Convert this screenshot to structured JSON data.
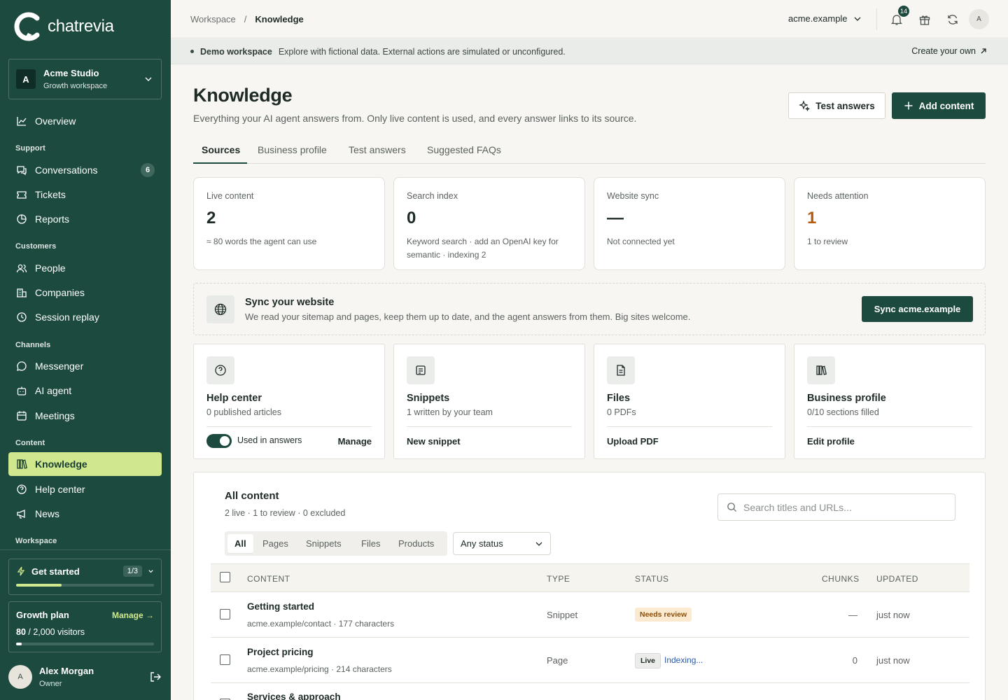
{
  "sidebar": {
    "brand": "chatrevia",
    "workspace": {
      "initial": "A",
      "name": "Acme Studio",
      "plan": "Growth workspace"
    },
    "nav": {
      "overview": "Overview",
      "support_section": "Support",
      "conversations": "Conversations",
      "conversations_badge": "6",
      "tickets": "Tickets",
      "reports": "Reports",
      "customers_section": "Customers",
      "people": "People",
      "companies": "Companies",
      "session_replay": "Session replay",
      "channels_section": "Channels",
      "messenger": "Messenger",
      "ai_agent": "AI agent",
      "meetings": "Meetings",
      "content_section": "Content",
      "knowledge": "Knowledge",
      "help_center": "Help center",
      "news": "News",
      "workspace_section": "Workspace"
    },
    "get_started": {
      "label": "Get started",
      "count": "1/3",
      "progress": 0.33
    },
    "plan": {
      "name": "Growth plan",
      "manage": "Manage →",
      "used": "80",
      "limit": "/ 2,000 visitors",
      "progress": 0.04
    },
    "user": {
      "initial": "A",
      "name": "Alex Morgan",
      "role": "Owner"
    }
  },
  "topbar": {
    "breadcrumb_root": "Workspace",
    "breadcrumb_sep": "/",
    "breadcrumb_current": "Knowledge",
    "domain": "acme.example",
    "notifications": "14",
    "avatar": "A"
  },
  "banner": {
    "label": "Demo workspace",
    "text": "Explore with fictional data. External actions are simulated or unconfigured.",
    "cta": "Create your own"
  },
  "page": {
    "title": "Knowledge",
    "subtitle": "Everything your AI agent answers from. Only live content is used, and every answer links to its source.",
    "test_button": "Test answers",
    "add_button": "Add content"
  },
  "tabs": [
    "Sources",
    "Business profile",
    "Test answers",
    "Suggested FAQs"
  ],
  "stats": [
    {
      "label": "Live content",
      "value": "2",
      "sub": "≈ 80 words the agent can use"
    },
    {
      "label": "Search index",
      "value": "0",
      "sub": "Keyword search · add an OpenAI key for semantic · indexing 2"
    },
    {
      "label": "Website sync",
      "value": "—",
      "sub": "Not connected yet"
    },
    {
      "label": "Needs attention",
      "value": "1",
      "sub": "1 to review"
    }
  ],
  "sync": {
    "title": "Sync your website",
    "text": "We read your sitemap and pages, keep them up to date, and the agent answers from them. Big sites welcome.",
    "button": "Sync acme.example"
  },
  "sources": [
    {
      "title": "Help center",
      "sub": "0 published articles",
      "toggle_label": "Used in answers",
      "toggle_on": true,
      "action": "Manage"
    },
    {
      "title": "Snippets",
      "sub": "1 written by your team",
      "action": "New snippet"
    },
    {
      "title": "Files",
      "sub": "0 PDFs",
      "action": "Upload PDF"
    },
    {
      "title": "Business profile",
      "sub": "0/10 sections filled",
      "action": "Edit profile"
    }
  ],
  "content": {
    "title": "All content",
    "summary": "2 live · 1 to review · 0 excluded",
    "search_placeholder": "Search titles and URLs...",
    "filters": [
      "All",
      "Pages",
      "Snippets",
      "Files",
      "Products"
    ],
    "status_filter": "Any status",
    "columns": {
      "content": "CONTENT",
      "type": "TYPE",
      "status": "STATUS",
      "chunks": "CHUNKS",
      "updated": "UPDATED"
    },
    "rows": [
      {
        "title": "Getting started",
        "meta": "acme.example/contact · 177 characters",
        "type": "Snippet",
        "status": "Needs review",
        "chunks": "—",
        "updated": "just now"
      },
      {
        "title": "Project pricing",
        "meta": "acme.example/pricing · 214 characters",
        "type": "Page",
        "status": "Live",
        "status_extra": "Indexing...",
        "chunks": "0",
        "updated": "just now"
      },
      {
        "title": "Services & approach"
      }
    ]
  },
  "colors": {
    "brand": "#1c4a3f",
    "accent": "#cfe88e",
    "warning": "#b35c10"
  }
}
